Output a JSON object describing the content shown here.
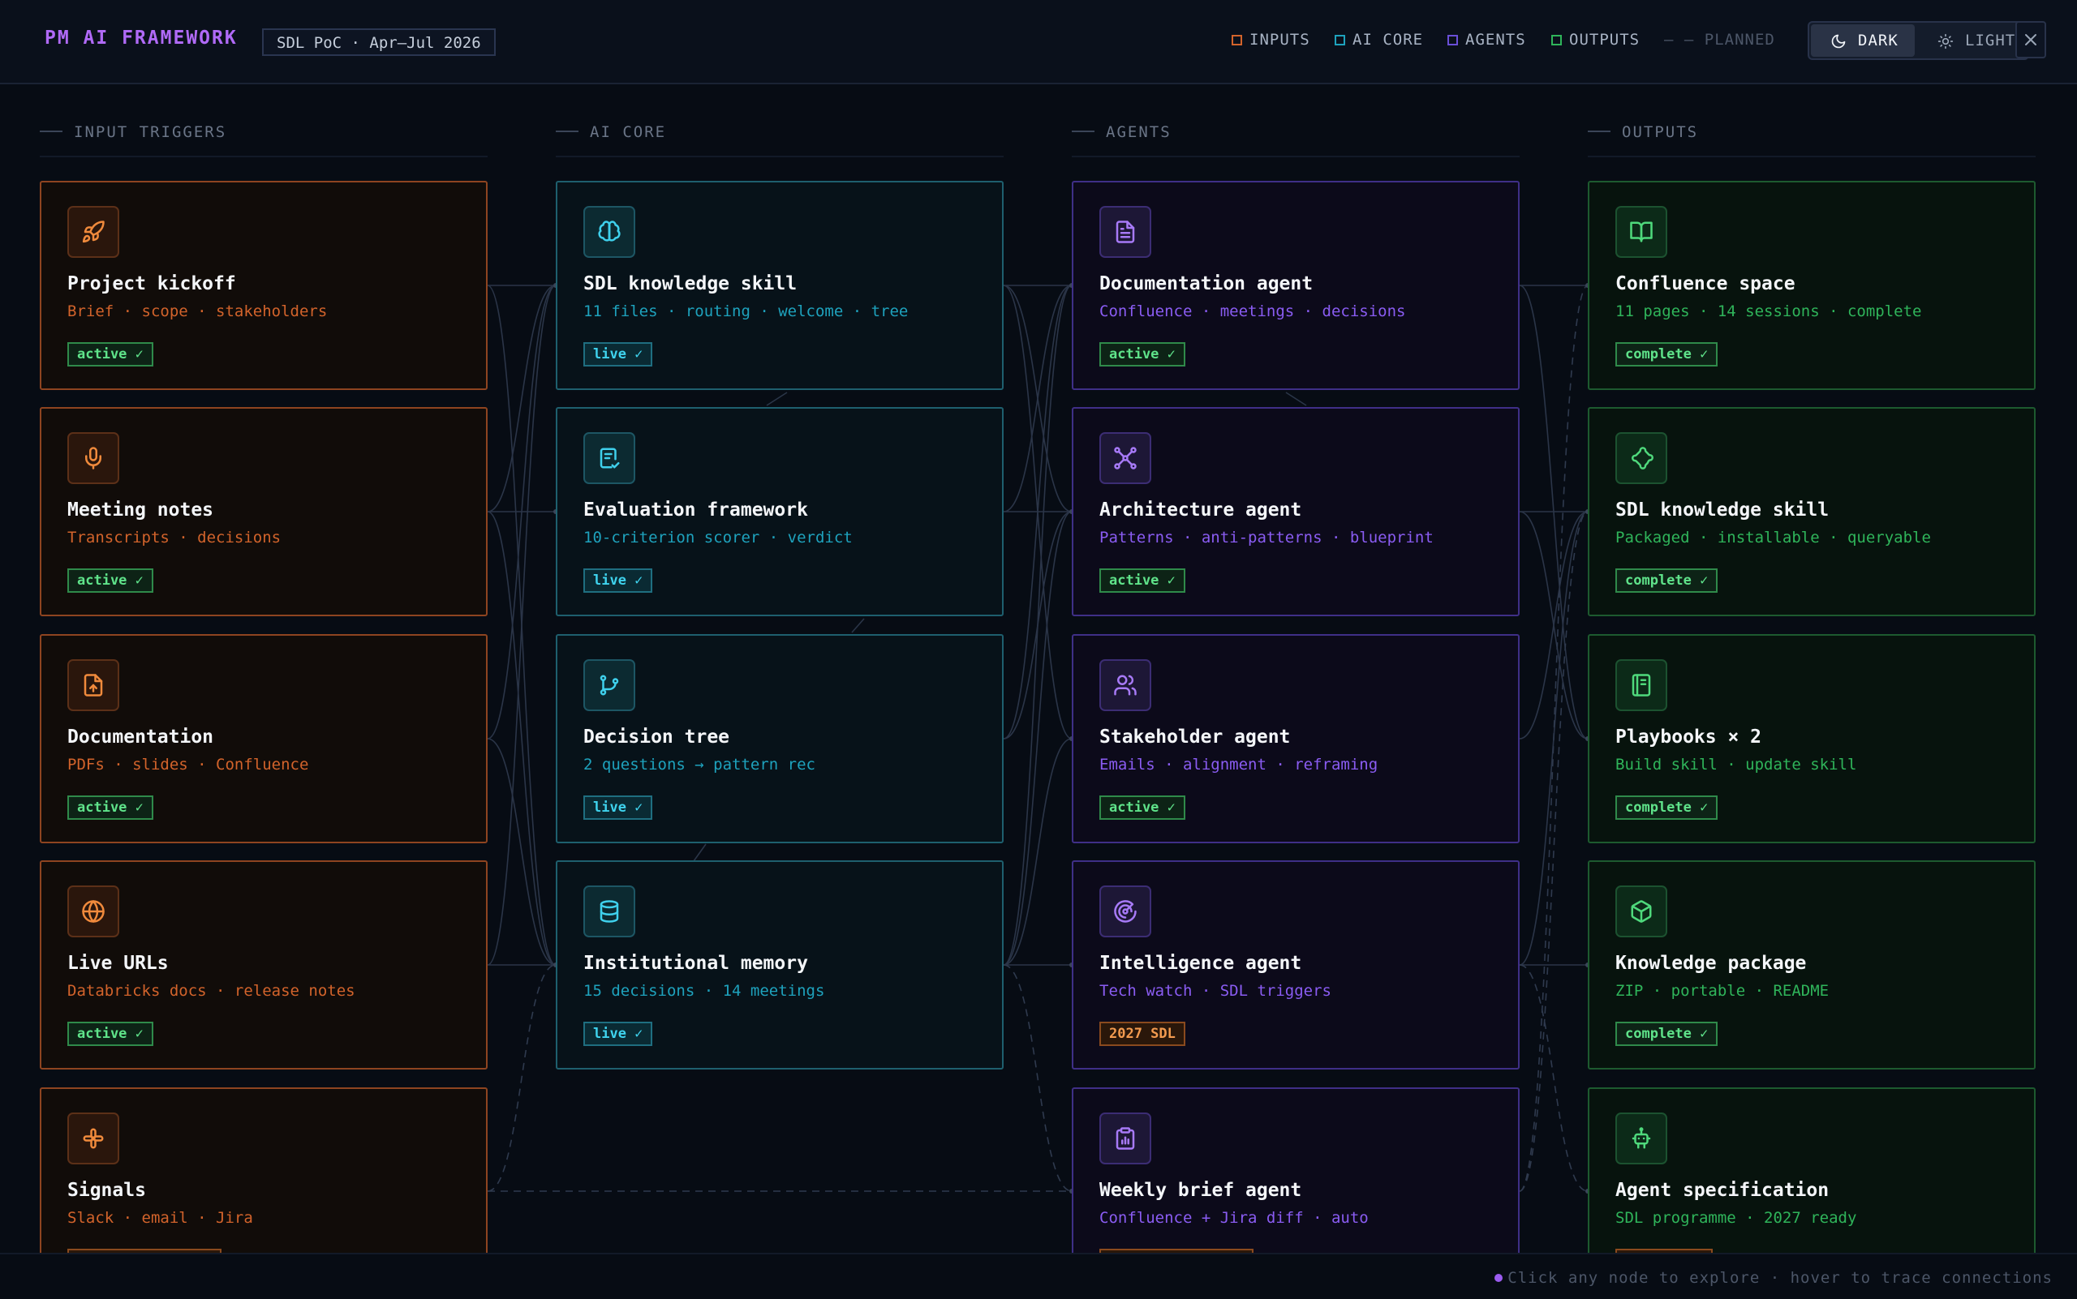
{
  "header": {
    "brand": "PM AI FRAMEWORK",
    "project_pill": "SDL PoC · Apr–Jul 2026",
    "legend": [
      {
        "label": "INPUTS",
        "color": "#d2632b"
      },
      {
        "label": "AI CORE",
        "color": "#1ea2bd"
      },
      {
        "label": "AGENTS",
        "color": "#6a4fd8"
      },
      {
        "label": "OUTPUTS",
        "color": "#2fb45a"
      },
      {
        "label": "— — PLANNED",
        "color": "#4c5668"
      }
    ],
    "theme_dark": "DARK",
    "theme_light": "LIGHT",
    "active_theme": "DARK"
  },
  "columns": [
    "INPUT TRIGGERS",
    "AI CORE",
    "AGENTS",
    "OUTPUTS"
  ],
  "inputs": [
    {
      "title": "Project kickoff",
      "sub": "Brief · scope · stakeholders",
      "badge": "active ✓",
      "icon": "rocket-icon"
    },
    {
      "title": "Meeting notes",
      "sub": "Transcripts · decisions",
      "badge": "active ✓",
      "icon": "microphone-icon"
    },
    {
      "title": "Documentation",
      "sub": "PDFs · slides · Confluence",
      "badge": "active ✓",
      "icon": "file-upload-icon"
    },
    {
      "title": "Live URLs",
      "sub": "Databricks docs · release notes",
      "badge": "active ✓",
      "icon": "globe-icon"
    },
    {
      "title": "Signals",
      "sub": "Slack · email · Jira",
      "badge": "",
      "icon": "slack-icon"
    }
  ],
  "core": [
    {
      "title": "SDL knowledge skill",
      "sub": "11 files · routing · welcome · tree",
      "badge": "live ✓",
      "icon": "brain-icon"
    },
    {
      "title": "Evaluation framework",
      "sub": "10-criterion scorer · verdict",
      "badge": "live ✓",
      "icon": "checklist-icon"
    },
    {
      "title": "Decision tree",
      "sub": "2 questions → pattern rec",
      "badge": "live ✓",
      "icon": "git-branch-icon"
    },
    {
      "title": "Institutional memory",
      "sub": "15 decisions · 14 meetings",
      "badge": "live ✓",
      "icon": "database-icon"
    }
  ],
  "agents": [
    {
      "title": "Documentation agent",
      "sub": "Confluence · meetings · decisions",
      "badge": "active ✓",
      "icon": "document-icon"
    },
    {
      "title": "Architecture agent",
      "sub": "Patterns · anti-patterns · blueprint",
      "badge": "active ✓",
      "icon": "network-icon"
    },
    {
      "title": "Stakeholder agent",
      "sub": "Emails · alignment · reframing",
      "badge": "active ✓",
      "icon": "users-icon"
    },
    {
      "title": "Intelligence agent",
      "sub": "Tech watch · SDL triggers",
      "badge": "2027 SDL",
      "icon": "radar-icon"
    },
    {
      "title": "Weekly brief agent",
      "sub": "Confluence + Jira diff · auto",
      "badge": "",
      "icon": "clipboard-chart-icon"
    }
  ],
  "outputs": [
    {
      "title": "Confluence space",
      "sub": "11 pages · 14 sessions · complete",
      "badge": "complete ✓",
      "icon": "book-open-icon"
    },
    {
      "title": "SDL knowledge skill",
      "sub": "Packaged · installable · queryable",
      "badge": "complete ✓",
      "icon": "puzzle-icon"
    },
    {
      "title": "Playbooks × 2",
      "sub": "Build skill · update skill",
      "badge": "complete ✓",
      "icon": "notebook-icon"
    },
    {
      "title": "Knowledge package",
      "sub": "ZIP · portable · README",
      "badge": "complete ✓",
      "icon": "package-icon"
    },
    {
      "title": "Agent specification",
      "sub": "SDL programme · 2027 ready",
      "badge": "",
      "icon": "robot-icon"
    }
  ],
  "footer": {
    "hint": "Click any node to explore · hover to trace connections"
  }
}
